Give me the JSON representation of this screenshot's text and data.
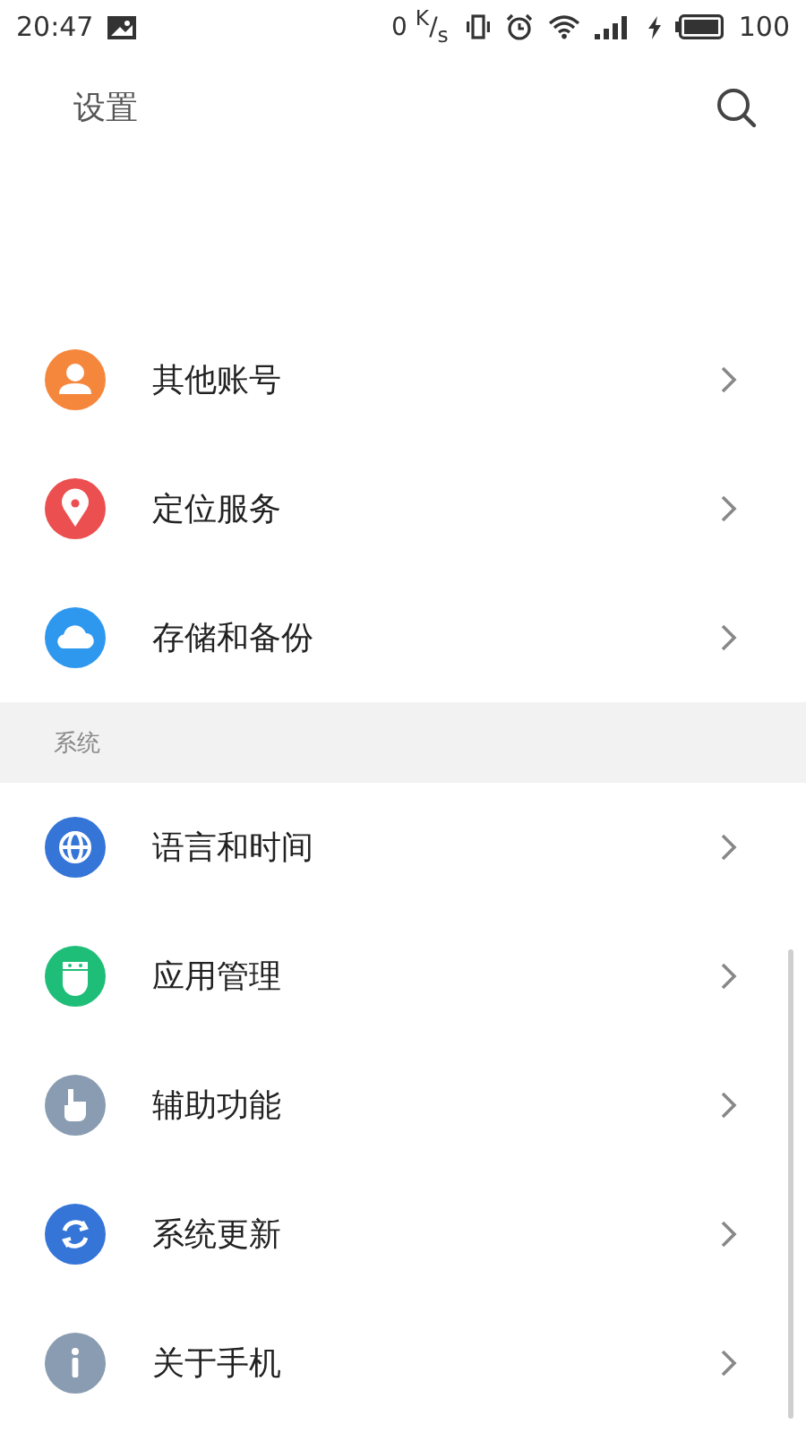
{
  "status_bar": {
    "time": "20:47",
    "speed": "0 $^{K}$/$_{s}$",
    "battery": "100"
  },
  "header": {
    "title": "设置"
  },
  "groups": [
    {
      "items": [
        {
          "kind": "person",
          "label": "其他账号",
          "color": "#f5873d"
        },
        {
          "kind": "pin",
          "label": "定位服务",
          "color": "#ec4f4f"
        },
        {
          "kind": "cloud",
          "label": "存储和备份",
          "color": "#2e98ef"
        }
      ]
    },
    {
      "title": "系统",
      "items": [
        {
          "kind": "globe",
          "label": "语言和时间",
          "color": "#3575d8"
        },
        {
          "kind": "android",
          "label": "应用管理",
          "color": "#1fbe78"
        },
        {
          "kind": "hand",
          "label": "辅助功能",
          "color": "#8a9cb1"
        },
        {
          "kind": "sync",
          "label": "系统更新",
          "color": "#3575d8"
        },
        {
          "kind": "info",
          "label": "关于手机",
          "color": "#8a9cb1"
        }
      ]
    }
  ]
}
